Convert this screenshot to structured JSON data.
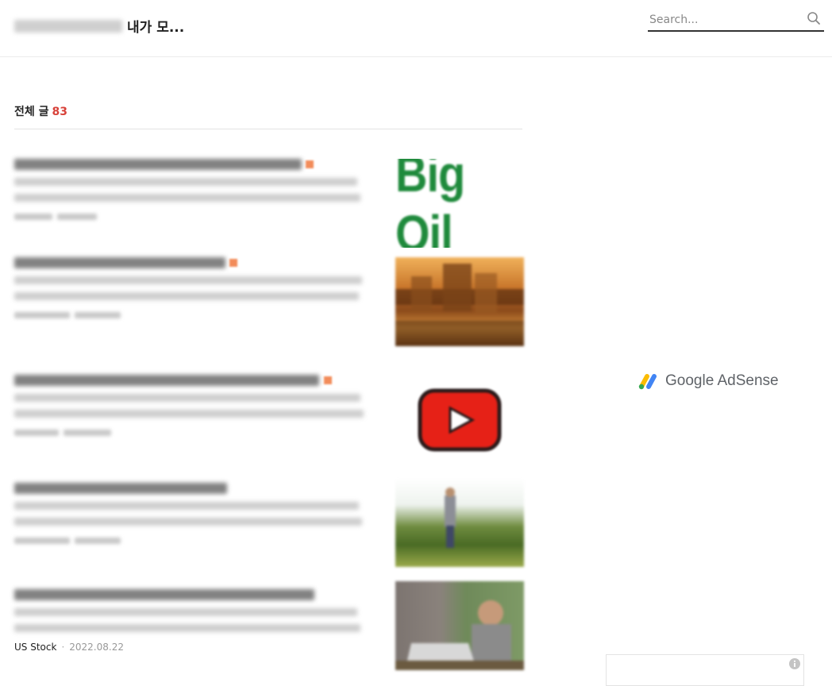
{
  "header": {
    "title_suffix": "내가 모...",
    "search": {
      "placeholder": "Search..."
    }
  },
  "list": {
    "heading_label": "전체 글",
    "heading_count": "83"
  },
  "posts": [
    {
      "thumbnail": "Big Oil",
      "new": true
    },
    {
      "thumbnail": "city-photo",
      "new": true
    },
    {
      "thumbnail": "youtube-logo",
      "new": true
    },
    {
      "thumbnail": "field-photo",
      "new": false
    },
    {
      "thumbnail": "laptop-photo",
      "new": false,
      "category": "US Stock",
      "date": "2022.08.22"
    }
  ],
  "ad": {
    "logo_text": "Google AdSense",
    "colors": {
      "blue": "#4285F4",
      "yellow": "#FBBC04",
      "green": "#34A853"
    }
  },
  "colors": {
    "count_accent": "#d8423a",
    "big_oil_green": "#1f8a3c",
    "youtube_red": "#e62117"
  }
}
